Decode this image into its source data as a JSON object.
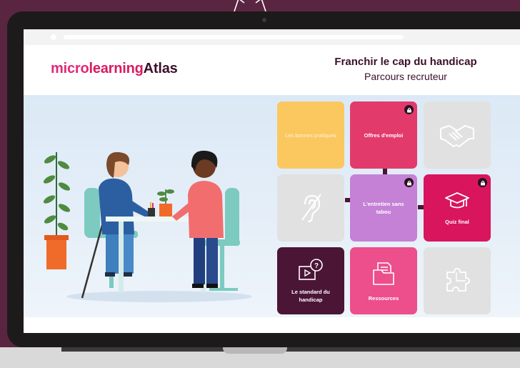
{
  "brand": {
    "part1": "micro",
    "part2": "learning",
    "part3": "Atlas"
  },
  "course": {
    "title": "Franchir le cap du handicap",
    "subtitle": "Parcours recruteur"
  },
  "tiles": [
    {
      "label": "Les bonnes pratiques",
      "color": "#fbc860",
      "locked": false
    },
    {
      "label": "Offres d'emploi",
      "color": "#e33a6c",
      "locked": true
    },
    {
      "label": "",
      "color": "#e1e1e1",
      "icon": "handshake-icon",
      "locked": false
    },
    {
      "label": "",
      "color": "#e1e1e1",
      "icon": "ear-icon",
      "locked": false
    },
    {
      "label": "L'entretien sans tabou",
      "color": "#c581d6",
      "locked": true
    },
    {
      "label": "Quiz final",
      "color": "#d8155d",
      "icon": "graduation-cap-icon",
      "locked": true
    },
    {
      "label": "Le standard du handicap",
      "color": "#4b1536",
      "icon": "video-question-icon",
      "locked": false
    },
    {
      "label": "Ressources",
      "color": "#ec4f8b",
      "icon": "documents-icon",
      "locked": false
    },
    {
      "label": "",
      "color": "#e1e1e1",
      "icon": "puzzle-icon",
      "locked": false
    }
  ],
  "colors": {
    "background": "#5a2540",
    "brand_pink": "#e2277a",
    "brand_dark": "#3b0f2b"
  }
}
